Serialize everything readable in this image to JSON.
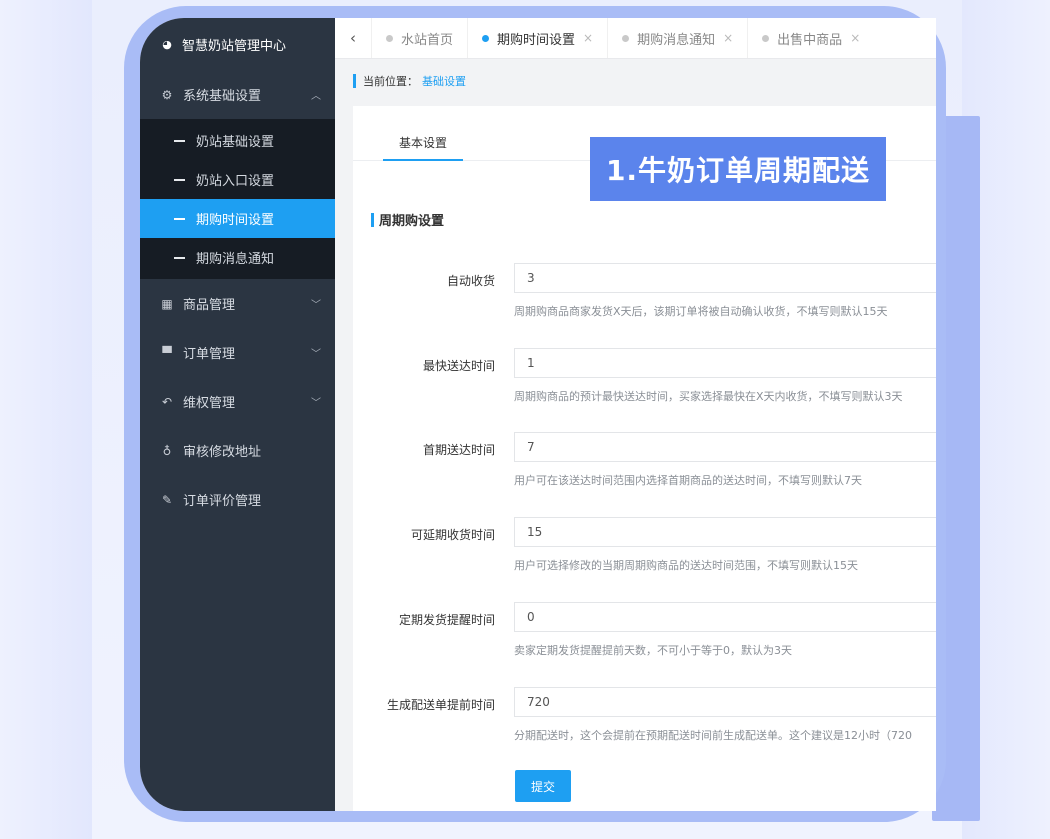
{
  "sidebar": {
    "brand": "智慧奶站管理中心",
    "items": [
      {
        "label": "系统基础设置",
        "icon": "gear-icon",
        "expanded": true,
        "children": [
          "奶站基础设置",
          "奶站入口设置",
          "期购时间设置",
          "期购消息通知"
        ],
        "active_child": "期购时间设置"
      },
      {
        "label": "商品管理",
        "icon": "calendar-icon"
      },
      {
        "label": "订单管理",
        "icon": "cart-icon"
      },
      {
        "label": "维权管理",
        "icon": "reply-icon"
      },
      {
        "label": "审核修改地址",
        "icon": "lightbulb-icon"
      },
      {
        "label": "订单评价管理",
        "icon": "edit-icon"
      }
    ]
  },
  "tabs": [
    {
      "label": "水站首页",
      "active": false,
      "closable": false
    },
    {
      "label": "期购时间设置",
      "active": true,
      "closable": true
    },
    {
      "label": "期购消息通知",
      "active": false,
      "closable": true
    },
    {
      "label": "出售中商品",
      "active": false,
      "closable": true
    }
  ],
  "tab_close_glyph": "×",
  "breadcrumb": {
    "prefix": "当前位置：",
    "current": "基础设置"
  },
  "subtab": "基本设置",
  "section_title": "周期购设置",
  "fields": [
    {
      "label": "自动收货",
      "value": "3",
      "help": "周期购商品商家发货X天后，该期订单将被自动确认收货，不填写则默认15天"
    },
    {
      "label": "最快送达时间",
      "value": "1",
      "help": "周期购商品的预计最快送达时间，买家选择最快在X天内收货，不填写则默认3天"
    },
    {
      "label": "首期送达时间",
      "value": "7",
      "help": "用户可在该送达时间范围内选择首期商品的送达时间，不填写则默认7天"
    },
    {
      "label": "可延期收货时间",
      "value": "15",
      "help": "用户可选择修改的当期周期购商品的送达时间范围，不填写则默认15天"
    },
    {
      "label": "定期发货提醒时间",
      "value": "0",
      "help": "卖家定期发货提醒提前天数，不可小于等于0，默认为3天"
    },
    {
      "label": "生成配送单提前时间",
      "value": "720",
      "help": "分期配送时，这个会提前在预期配送时间前生成配送单。这个建议是12小时（720"
    }
  ],
  "submit_label": "提交",
  "promo_text": "1.牛奶订单周期配送",
  "colors": {
    "accent": "#1e9ff2",
    "sidebar": "#2b3542",
    "submenu": "#161c24",
    "frame": "#a9bcf6",
    "promo": "#5b84ec"
  }
}
